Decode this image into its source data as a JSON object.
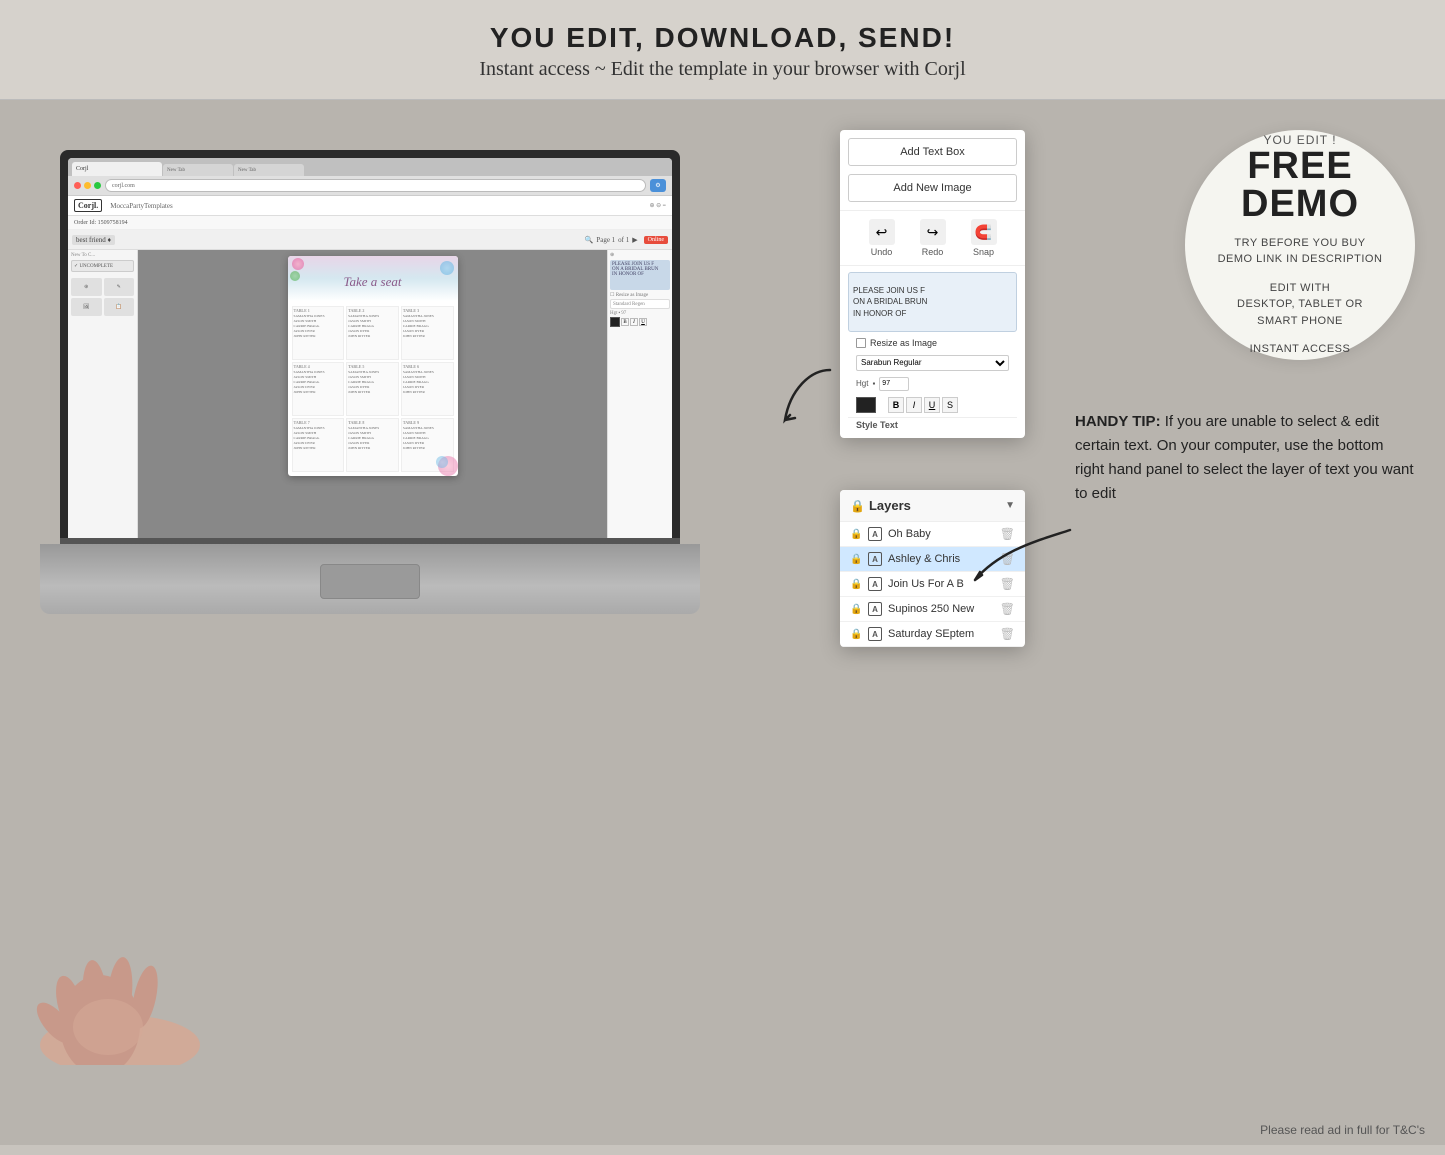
{
  "banner": {
    "title": "YOU EDIT, DOWNLOAD, SEND!",
    "subtitle": "Instant access ~ Edit the template in your browser with Corjl"
  },
  "demo_circle": {
    "you_edit": "YOU EDIT !",
    "free": "FREE",
    "demo": "DEMO",
    "line1": "TRY BEFORE YOU BUY",
    "line2": "DEMO LINK IN DESCRIPTION",
    "line3": "EDIT WITH",
    "line4": "DESKTOP, TABLET OR",
    "line5": "SMART PHONE",
    "line6": "INSTANT ACCESS"
  },
  "handy_tip": {
    "label": "HANDY TIP:",
    "text": "If you are unable to select & edit certain text. On your computer, use the bottom right hand panel to select the layer of text you want to edit"
  },
  "panel": {
    "add_text_box": "Add Text Box",
    "add_new_image": "Add New Image",
    "undo": "Undo",
    "redo": "Redo",
    "snap": "Snap"
  },
  "layers": {
    "title": "Layers",
    "items": [
      {
        "name": "Oh Baby",
        "locked": true,
        "type": "A"
      },
      {
        "name": "Ashley & Chris",
        "locked": true,
        "type": "A",
        "active": true
      },
      {
        "name": "Join Us For A B",
        "locked": true,
        "type": "A"
      },
      {
        "name": "Supinos 250 New",
        "locked": true,
        "type": "A"
      },
      {
        "name": "Saturday SEptem",
        "locked": true,
        "type": "A"
      }
    ]
  },
  "seating_chart": {
    "title": "Take a seat",
    "tables": [
      {
        "header": "TABLE 1",
        "names": "SAMANTHA JONES\nJASON SMITH\nCAMILLE BROWN\nTAYLOR JONES"
      },
      {
        "header": "TABLE 2",
        "names": "SAMANTHA JONES\nJASON SMITH\nCAMILLE BROWN\nTAYLOR JONES"
      },
      {
        "header": "TABLE 3",
        "names": "SAMANTHA JONES\nJASON SMITH\nCAMILLE BROWN\nTAYLOR JONES"
      },
      {
        "header": "TABLE 4",
        "names": "SAMANTHA JONES\nJASON SMITH\nCAMILLE BROWN\nTAYLOR JONES"
      },
      {
        "header": "TABLE 5",
        "names": "SAMANTHA JONES\nJASON SMITH\nCAMILLE BROWN\nTAYLOR JONES"
      },
      {
        "header": "TABLE 6",
        "names": "SAMANTHA JONES\nJASON SMITH\nCAMILLE BROWN\nTAYLOR JONES"
      },
      {
        "header": "TABLE 7",
        "names": "SAMANTHA JONES\nJASON SMITH\nCAMILLE BROWN\nTAYLOR JONES"
      },
      {
        "header": "TABLE 8",
        "names": "SAMANTHA JONES\nJASON SMITH\nCAMILLE BROWN\nTAYLOR JONES"
      },
      {
        "header": "TABLE 9",
        "names": "SAMANTHA JONES\nJASON SMITH\nCAMILLE BROWN\nTAYLOR JONES"
      }
    ]
  },
  "footer": {
    "text": "Please read ad in full for T&C's"
  },
  "browser": {
    "tabs": [
      "Corjl",
      "New Tab",
      "New Tab"
    ],
    "url": "corjl.com"
  },
  "order": {
    "id": "Order Id: 1509758194"
  }
}
